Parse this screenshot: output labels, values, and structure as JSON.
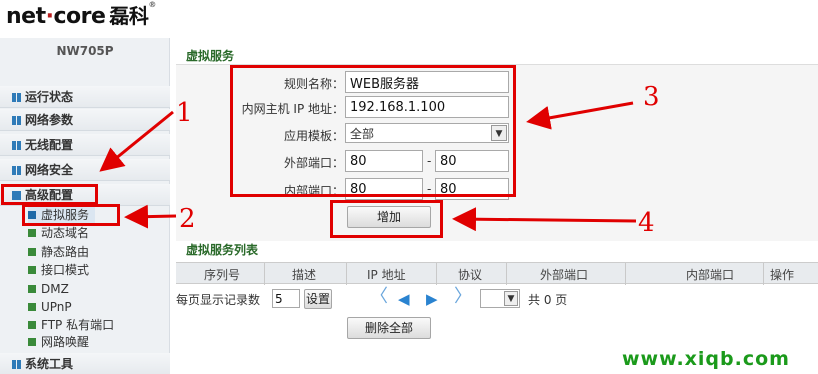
{
  "brand": {
    "logo_left": "net",
    "logo_right": "core",
    "logo_cn": "磊科",
    "reg": "®"
  },
  "sidebar": {
    "model": "NW705P",
    "items": [
      {
        "label": "运行状态"
      },
      {
        "label": "网络参数"
      },
      {
        "label": "无线配置"
      },
      {
        "label": "网络安全"
      },
      {
        "label": "高级配置"
      }
    ],
    "subitems": [
      {
        "label": "虚拟服务"
      },
      {
        "label": "动态域名"
      },
      {
        "label": "静态路由"
      },
      {
        "label": "接口模式"
      },
      {
        "label": "DMZ"
      },
      {
        "label": "UPnP"
      },
      {
        "label": "FTP 私有端口"
      },
      {
        "label": "网路唤醒"
      }
    ],
    "system_tools": "系统工具"
  },
  "form": {
    "section_title": "虚拟服务",
    "rule_name_label": "规则名称：",
    "rule_name_value": "WEB服务器",
    "ip_label": "内网主机 IP 地址：",
    "ip_value": "192.168.1.100",
    "template_label": "应用模板：",
    "template_value": "全部",
    "ext_port_label": "外部端口：",
    "ext_port_from": "80",
    "ext_port_to": "80",
    "int_port_label": "内部端口：",
    "int_port_from": "80",
    "int_port_to": "80",
    "dash": "-",
    "add_button": "增加"
  },
  "list": {
    "section_title": "虚拟服务列表",
    "columns": [
      "序列号",
      "描述",
      "IP 地址",
      "协议",
      "外部端口",
      "内部端口",
      "操作"
    ],
    "per_page_label": "每页显示记录数",
    "per_page_value": "5",
    "set_button": "设置",
    "total_text": "共 0 页",
    "delete_all_button": "删除全部"
  },
  "annotations": {
    "n1": "1",
    "n2": "2",
    "n3": "3",
    "n4": "4"
  },
  "watermark": "www.xiqb.com",
  "colors": {
    "annotation_red": "#e00000",
    "section_green": "#2a6a2a",
    "watermark_green": "#1b9a1b",
    "arrow_blue": "#2a83d0"
  }
}
